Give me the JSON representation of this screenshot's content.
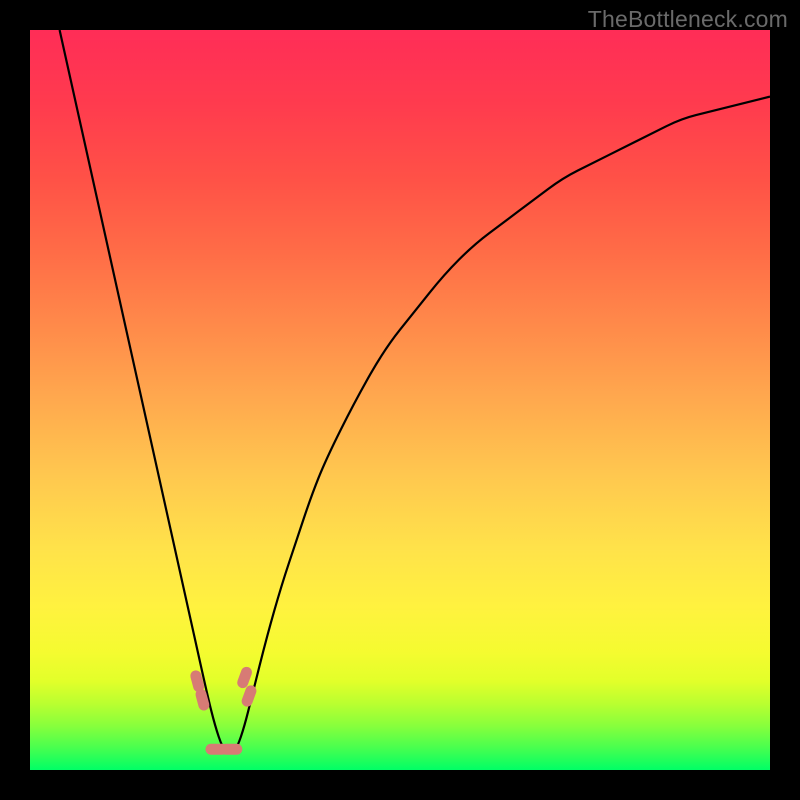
{
  "watermark": "TheBottleneck.com",
  "chart_data": {
    "type": "line",
    "title": "",
    "xlabel": "",
    "ylabel": "",
    "xlim": [
      0,
      100
    ],
    "ylim": [
      0,
      100
    ],
    "grid": false,
    "legend": false,
    "valley_x": 26,
    "series": [
      {
        "name": "curve",
        "x": [
          4,
          6,
          8,
          10,
          12,
          14,
          16,
          18,
          20,
          22,
          24,
          25,
          26,
          27,
          28,
          29,
          30,
          32,
          34,
          36,
          38,
          40,
          44,
          48,
          52,
          56,
          60,
          64,
          68,
          72,
          76,
          80,
          84,
          88,
          92,
          96,
          100
        ],
        "values": [
          100,
          91,
          82,
          73,
          64,
          55,
          46,
          37,
          28,
          19,
          10,
          6,
          3,
          2,
          3,
          6,
          10,
          18,
          25,
          31,
          37,
          42,
          50,
          57,
          62,
          67,
          71,
          74,
          77,
          80,
          82,
          84,
          86,
          88,
          89,
          90,
          91
        ]
      }
    ],
    "annotations": [
      {
        "type": "marker-cluster",
        "approx_x_range": [
          22,
          30
        ],
        "approx_y_range": [
          4,
          14
        ],
        "color": "#d77b75"
      }
    ],
    "gradient_bands": [
      {
        "y": 0,
        "color": "#00ff66"
      },
      {
        "y": 3,
        "color": "#48ff4f"
      },
      {
        "y": 6,
        "color": "#88ff3c"
      },
      {
        "y": 9,
        "color": "#baff30"
      },
      {
        "y": 12,
        "color": "#e2ff2a"
      },
      {
        "y": 16,
        "color": "#f5fb30"
      },
      {
        "y": 22,
        "color": "#fff23f"
      },
      {
        "y": 30,
        "color": "#ffe24a"
      },
      {
        "y": 40,
        "color": "#ffc74f"
      },
      {
        "y": 50,
        "color": "#ffa94e"
      },
      {
        "y": 60,
        "color": "#ff8a4a"
      },
      {
        "y": 70,
        "color": "#ff6c47"
      },
      {
        "y": 80,
        "color": "#ff5147"
      },
      {
        "y": 90,
        "color": "#ff3b4e"
      },
      {
        "y": 100,
        "color": "#ff2d57"
      }
    ]
  }
}
